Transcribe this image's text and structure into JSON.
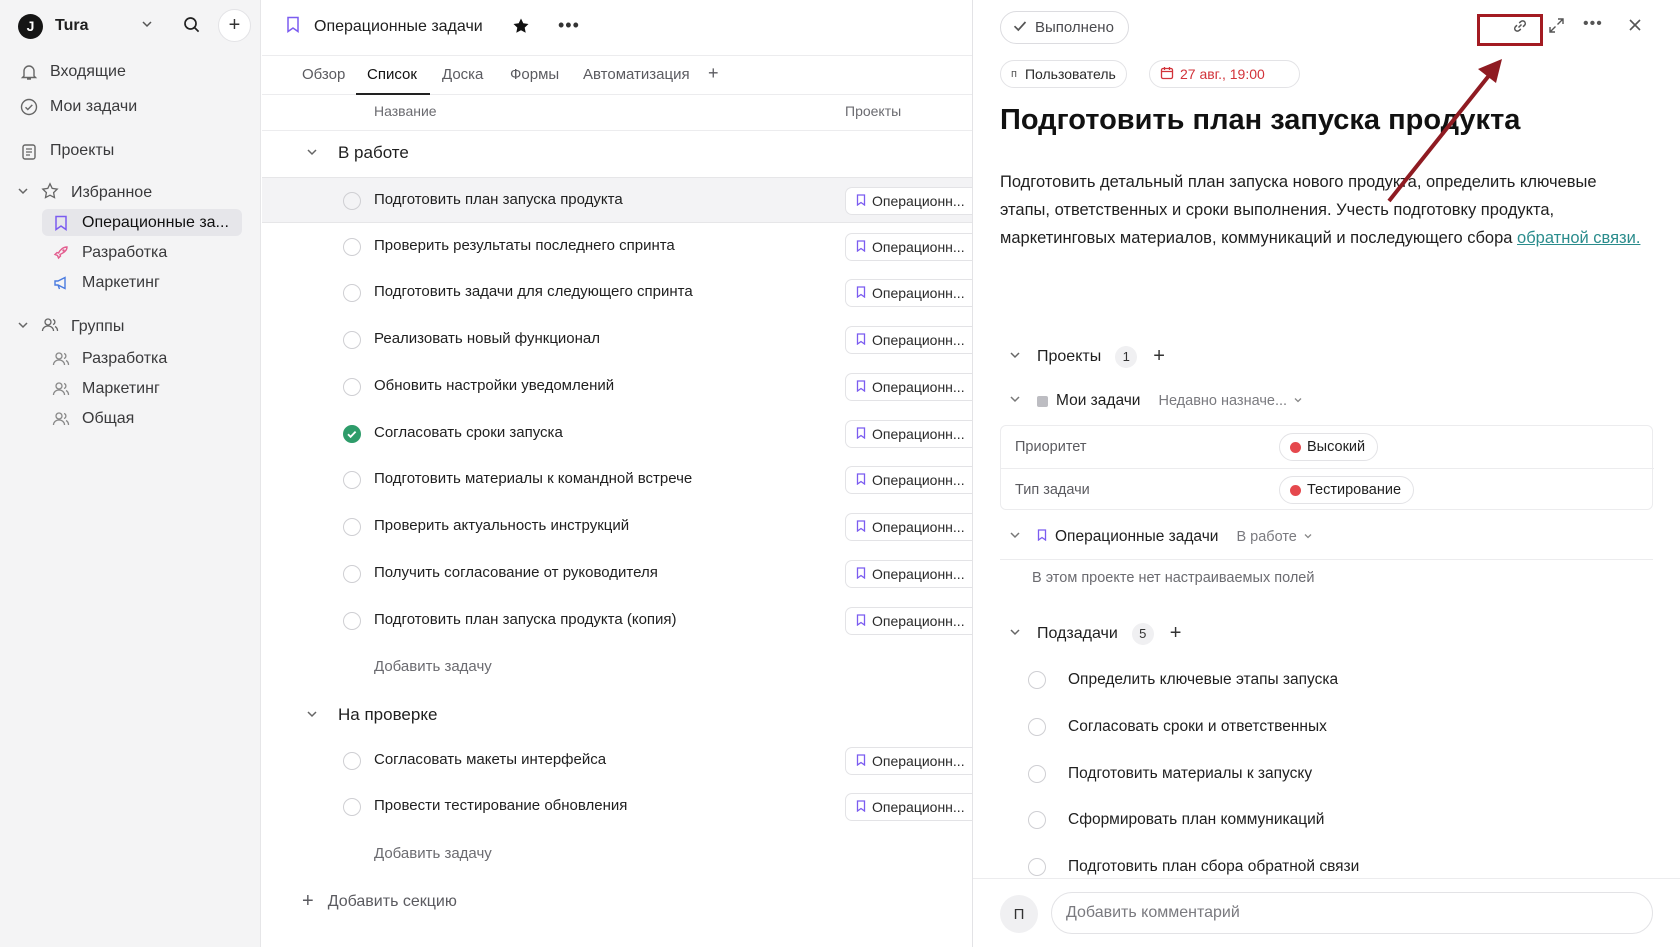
{
  "workspace": {
    "initial": "J",
    "name": "Tura"
  },
  "sidebar": {
    "nav": [
      {
        "label": "Входящие",
        "icon": "bell-icon"
      },
      {
        "label": "Мои задачи",
        "icon": "check-circle-icon"
      },
      {
        "label": "Проекты",
        "icon": "clipboard-icon"
      }
    ],
    "favorites": {
      "label": "Избранное",
      "items": [
        {
          "label": "Операционные за...",
          "icon": "bookmark-icon",
          "color": "#7b5cf0"
        },
        {
          "label": "Разработка",
          "icon": "rocket-icon",
          "color": "#e35d8f"
        },
        {
          "label": "Маркетинг",
          "icon": "megaphone-icon",
          "color": "#4a7be0"
        }
      ]
    },
    "groups": {
      "label": "Группы",
      "items": [
        {
          "label": "Разработка"
        },
        {
          "label": "Маркетинг"
        },
        {
          "label": "Общая"
        }
      ]
    }
  },
  "project": {
    "title": "Операционные задачи",
    "tabs": [
      "Обзор",
      "Список",
      "Доска",
      "Формы",
      "Автоматизация"
    ],
    "active_tab": "Список",
    "columns": {
      "name": "Название",
      "projects": "Проекты"
    },
    "project_pill": "Операционн...",
    "sections": [
      {
        "title": "В работе",
        "tasks": [
          {
            "title": "Подготовить план запуска продукта",
            "done": false,
            "selected": true
          },
          {
            "title": "Проверить результаты последнего спринта",
            "done": false
          },
          {
            "title": "Подготовить задачи для следующего спринта",
            "done": false
          },
          {
            "title": "Реализовать новый функционал",
            "done": false
          },
          {
            "title": "Обновить настройки уведомлений",
            "done": false
          },
          {
            "title": "Согласовать сроки запуска",
            "done": true
          },
          {
            "title": "Подготовить материалы к командной встрече",
            "done": false
          },
          {
            "title": "Проверить актуальность инструкций",
            "done": false
          },
          {
            "title": "Получить согласование от руководителя",
            "done": false
          },
          {
            "title": "Подготовить план запуска продукта (копия)",
            "done": false
          }
        ],
        "add_task": "Добавить задачу"
      },
      {
        "title": "На проверке",
        "tasks": [
          {
            "title": "Согласовать макеты интерфейса",
            "done": false
          },
          {
            "title": "Провести тестирование обновления",
            "done": false
          }
        ],
        "add_task": "Добавить задачу"
      }
    ],
    "add_section": "Добавить секцию"
  },
  "detail": {
    "done_label": "Выполнено",
    "assignee": {
      "initial": "п",
      "name": "Пользователь"
    },
    "due": "27 авг., 19:00",
    "title": "Подготовить план запуска продукта",
    "description": "Подготовить детальный план запуска нового продукта, определить ключевые этапы, ответственных и сроки выполнения. Учесть подготовку продукта, маркетинговых материалов, коммуникаций и последующего сбора ",
    "description_link": "обратной связи.",
    "projects_label": "Проекты",
    "projects_count": "1",
    "my_tasks": {
      "label": "Мои задачи",
      "status": "Недавно назначе..."
    },
    "fields": [
      {
        "label": "Приоритет",
        "value": "Высокий",
        "color": "#e5484d"
      },
      {
        "label": "Тип задачи",
        "value": "Тестирование",
        "color": "#e5484d"
      }
    ],
    "op_project": {
      "label": "Операционные задачи",
      "status": "В работе"
    },
    "no_fields": "В этом проекте нет настраиваемых полей",
    "subtasks_label": "Подзадачи",
    "subtasks_count": "5",
    "subtasks": [
      "Определить ключевые этапы запуска",
      "Согласовать сроки и ответственных",
      "Подготовить материалы к запуску",
      "Сформировать план коммуникаций",
      "Подготовить план сбора обратной связи"
    ],
    "comment": {
      "initial": "П",
      "placeholder": "Добавить комментарий"
    }
  },
  "colors": {
    "accent": "#7b5cf0",
    "highlight": "#a31b22",
    "done": "#2e9c6a",
    "link": "#2a8c8c"
  }
}
